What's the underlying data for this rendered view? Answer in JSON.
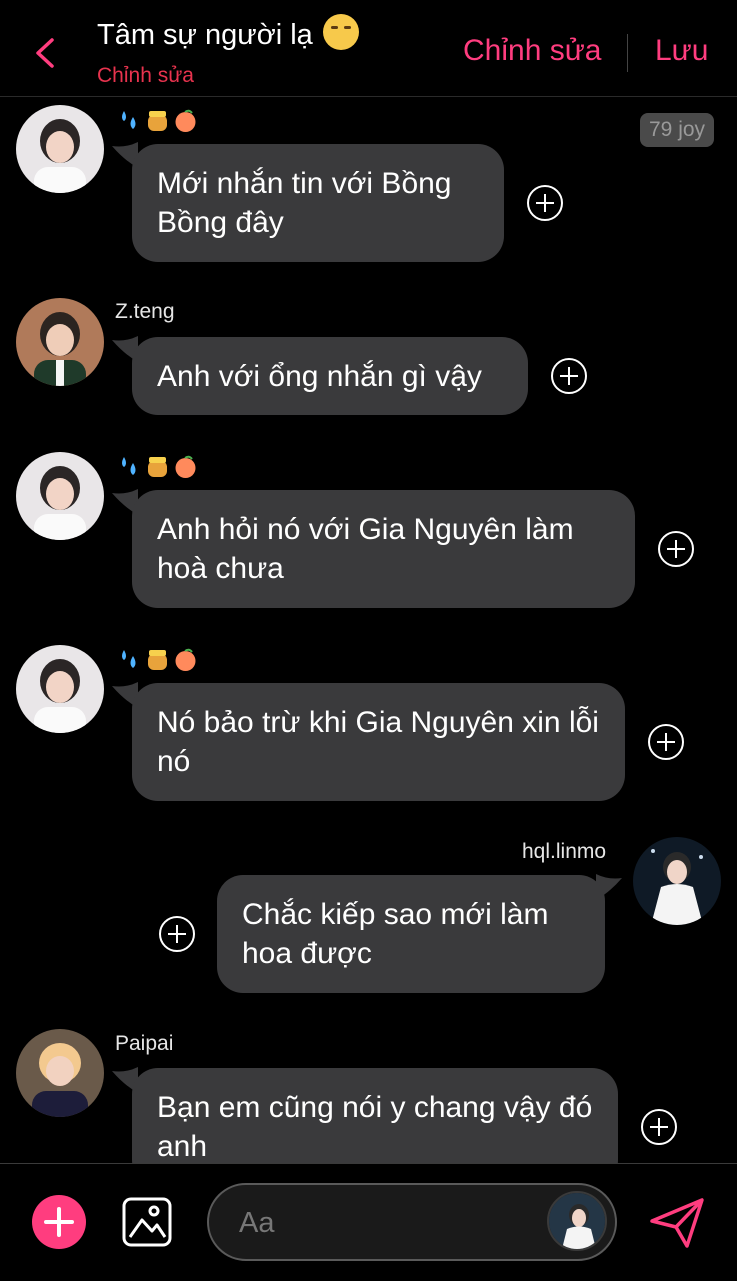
{
  "header": {
    "title": "Tâm sự người lạ",
    "subtitle": "Chỉnh sửa",
    "edit_label": "Chỉnh sửa",
    "save_label": "Lưu",
    "back_icon": "chevron-left-icon",
    "title_emoji": "smiling-face-icon"
  },
  "points_badge": "79 joy",
  "messages": [
    {
      "sender": "",
      "emojis": [
        "sweat-droplets-icon",
        "honey-pot-icon",
        "peach-icon"
      ],
      "text": "Mới nhắn tin với Bồng Bồng đây"
    },
    {
      "sender": "Z.teng",
      "emojis": [],
      "text": "Anh với ổng nhắn gì vậy"
    },
    {
      "sender": "",
      "emojis": [
        "sweat-droplets-icon",
        "honey-pot-icon",
        "peach-icon"
      ],
      "text": "Anh hỏi nó với Gia Nguyên làm hoà chưa"
    },
    {
      "sender": "",
      "emojis": [
        "sweat-droplets-icon",
        "honey-pot-icon",
        "peach-icon"
      ],
      "text": "Nó bảo trừ khi Gia Nguyên xin lỗi nó"
    },
    {
      "sender": "hql.linmo",
      "emojis": [],
      "text": "Chắc kiếp sao mới làm hoa được"
    },
    {
      "sender": "Paipai",
      "emojis": [],
      "text": "Bạn em cũng nói y chang vậy đó anh"
    }
  ],
  "composer": {
    "placeholder": "Aa",
    "add_icon": "plus-circle-icon",
    "image_icon": "image-icon",
    "send_icon": "send-icon"
  },
  "colors": {
    "accent": "#ff3d7f",
    "subtitle": "#e8334e",
    "bubble": "#3a3a3c",
    "background": "#000000"
  }
}
